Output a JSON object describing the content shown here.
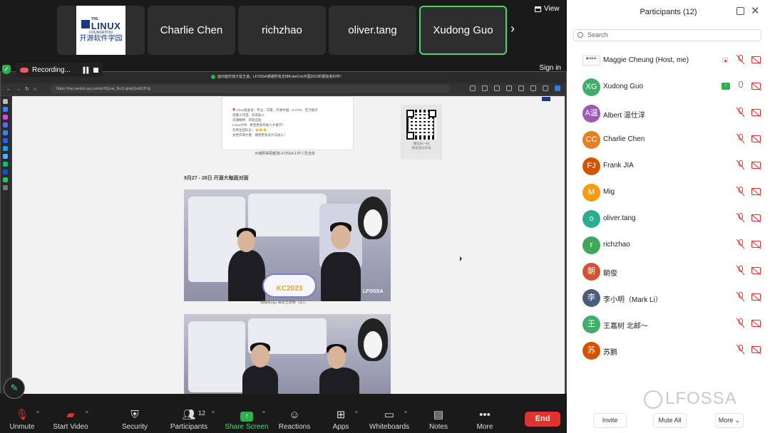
{
  "gallery": {
    "tiles": [
      {
        "name": "logo",
        "logo_line1": "THE",
        "logo_line2": "LINUX",
        "logo_line3": "FOUNDATION",
        "logo_line4": "开源软件学园"
      },
      {
        "name": "Charlie Chen"
      },
      {
        "name": "richzhao"
      },
      {
        "name": "oliver.tang"
      },
      {
        "name": "Xudong Guo",
        "active": true
      }
    ],
    "view_label": "View"
  },
  "recording": {
    "label": "Recording...",
    "signin": "Sign in"
  },
  "browser": {
    "notice": "面对面交流才是王道。LFOSSA感谢所有支持KubeCon中国2023的朋友和伙伴！",
    "url": "https://mp.weixin.qq.com/s/SQeai_NcS-ghejUoikOPJg"
  },
  "article": {
    "poster_lines": [
      "Linux基金会：专业、可靠、开源中国、5 CTO、百万端点",
      "思维工作室，欢迎加入",
      "开源精神：开放互助",
      "Linux大师：希望更多开发人才者可！",
      "云原生团队员：👏👏👏",
      "女性开源力量：期望更多女力与加入！"
    ],
    "poster_caption": "大咖照得更都送LFOSSA工作人员全体",
    "qr_caption_1": "微信扫一扫",
    "qr_caption_2": "关注该公众号",
    "date_heading": "9月27 - 28日 开源大咖面对面",
    "photo_sign": "KC2023",
    "photo_brand": "LFOSSA",
    "photo_caption": "郭旭东(右) 采访王泽锋（左）。"
  },
  "toolbar": {
    "unmute": "Unmute",
    "start_video": "Start Video",
    "security": "Security",
    "participants": "Participants",
    "participants_count": "12",
    "share_screen": "Share Screen",
    "reactions": "Reactions",
    "apps": "Apps",
    "whiteboards": "Whiteboards",
    "notes": "Notes",
    "more": "More",
    "end": "End"
  },
  "panel": {
    "title": "Participants (12)",
    "search_placeholder": "Search",
    "participants": [
      {
        "name": "Maggie Cheung (Host, me)",
        "avatar": "",
        "color": "#ffffff",
        "type": "logo",
        "extra": "flag",
        "mic": "muted"
      },
      {
        "name": "Xudong Guo",
        "avatar": "XG",
        "color": "#3fae6b",
        "extra": "share",
        "mic": "on"
      },
      {
        "name": "Albert 温仕淳",
        "avatar": "A温",
        "color": "#9b59b6",
        "mic": "muted"
      },
      {
        "name": "Charlie Chen",
        "avatar": "CC",
        "color": "#e67e22",
        "mic": "muted"
      },
      {
        "name": "Frank JIA",
        "avatar": "FJ",
        "color": "#d35400",
        "mic": "muted"
      },
      {
        "name": "Mig",
        "avatar": "M",
        "color": "#f39c12",
        "mic": "muted"
      },
      {
        "name": "oliver.tang",
        "avatar": "o",
        "color": "#2bae8f",
        "mic": "muted"
      },
      {
        "name": "richzhao",
        "avatar": "r",
        "color": "#3fa85a",
        "mic": "muted"
      },
      {
        "name": "朝俊",
        "avatar": "朝",
        "color": "#d35230",
        "mic": "muted"
      },
      {
        "name": "李小明（Mark Li）",
        "avatar": "李",
        "color": "#4a5d7e",
        "mic": "muted"
      },
      {
        "name": "王嘉树 北邮～",
        "avatar": "王",
        "color": "#3fae6b",
        "mic": "muted"
      },
      {
        "name": "苏鹏",
        "avatar": "苏",
        "color": "#d35400",
        "mic": "muted"
      }
    ],
    "invite": "Invite",
    "mute_all": "Mute All",
    "more": "More",
    "watermark": "LFOSSA"
  }
}
